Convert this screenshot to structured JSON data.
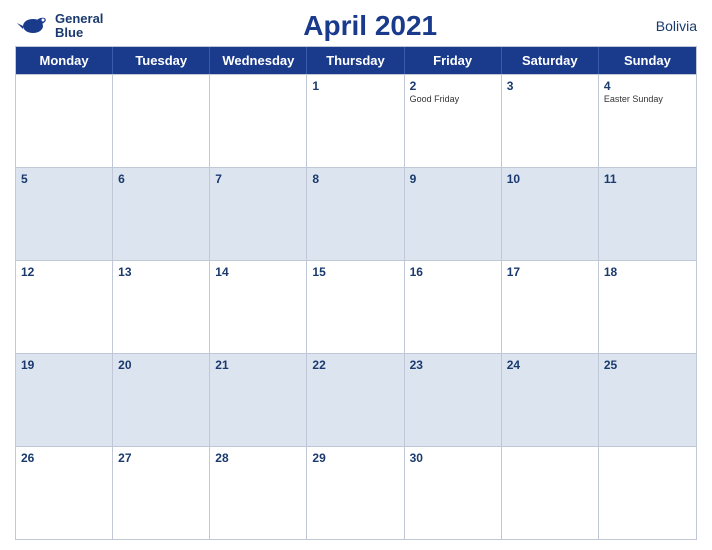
{
  "logo": {
    "line1": "General",
    "line2": "Blue"
  },
  "header": {
    "title": "April 2021",
    "country": "Bolivia"
  },
  "weekdays": [
    "Monday",
    "Tuesday",
    "Wednesday",
    "Thursday",
    "Friday",
    "Saturday",
    "Sunday"
  ],
  "rows": [
    [
      {
        "num": "",
        "event": "",
        "empty": true
      },
      {
        "num": "",
        "event": "",
        "empty": true
      },
      {
        "num": "",
        "event": "",
        "empty": true
      },
      {
        "num": "1",
        "event": ""
      },
      {
        "num": "2",
        "event": "Good Friday"
      },
      {
        "num": "3",
        "event": ""
      },
      {
        "num": "4",
        "event": "Easter Sunday"
      }
    ],
    [
      {
        "num": "5",
        "event": ""
      },
      {
        "num": "6",
        "event": ""
      },
      {
        "num": "7",
        "event": ""
      },
      {
        "num": "8",
        "event": ""
      },
      {
        "num": "9",
        "event": ""
      },
      {
        "num": "10",
        "event": ""
      },
      {
        "num": "11",
        "event": ""
      }
    ],
    [
      {
        "num": "12",
        "event": ""
      },
      {
        "num": "13",
        "event": ""
      },
      {
        "num": "14",
        "event": ""
      },
      {
        "num": "15",
        "event": ""
      },
      {
        "num": "16",
        "event": ""
      },
      {
        "num": "17",
        "event": ""
      },
      {
        "num": "18",
        "event": ""
      }
    ],
    [
      {
        "num": "19",
        "event": ""
      },
      {
        "num": "20",
        "event": ""
      },
      {
        "num": "21",
        "event": ""
      },
      {
        "num": "22",
        "event": ""
      },
      {
        "num": "23",
        "event": ""
      },
      {
        "num": "24",
        "event": ""
      },
      {
        "num": "25",
        "event": ""
      }
    ],
    [
      {
        "num": "26",
        "event": ""
      },
      {
        "num": "27",
        "event": ""
      },
      {
        "num": "28",
        "event": ""
      },
      {
        "num": "29",
        "event": ""
      },
      {
        "num": "30",
        "event": ""
      },
      {
        "num": "",
        "event": "",
        "empty": true
      },
      {
        "num": "",
        "event": "",
        "empty": true
      }
    ]
  ],
  "colors": {
    "header_bg": "#1a3a8c",
    "header_text": "#ffffff",
    "dark_row_bg": "#dce4f0",
    "light_row_bg": "#ffffff",
    "accent": "#1a3a6e"
  }
}
